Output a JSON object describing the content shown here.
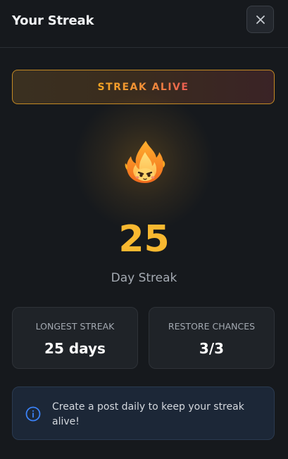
{
  "header": {
    "title": "Your Streak",
    "close_icon": "close-icon"
  },
  "status": {
    "label": "STREAK ALIVE",
    "gradient_start": "#f5a623",
    "gradient_end": "#ea5b53"
  },
  "streak": {
    "icon": "fire-face-icon",
    "count": "25",
    "label": "Day Streak",
    "accent": "#f8b830"
  },
  "stats": [
    {
      "label": "LONGEST STREAK",
      "value": "25 days"
    },
    {
      "label": "RESTORE CHANCES",
      "value": "3/3"
    }
  ],
  "info": {
    "icon": "info-icon",
    "text": "Create a post daily to keep your streak alive!",
    "accent": "#3b82f6"
  }
}
